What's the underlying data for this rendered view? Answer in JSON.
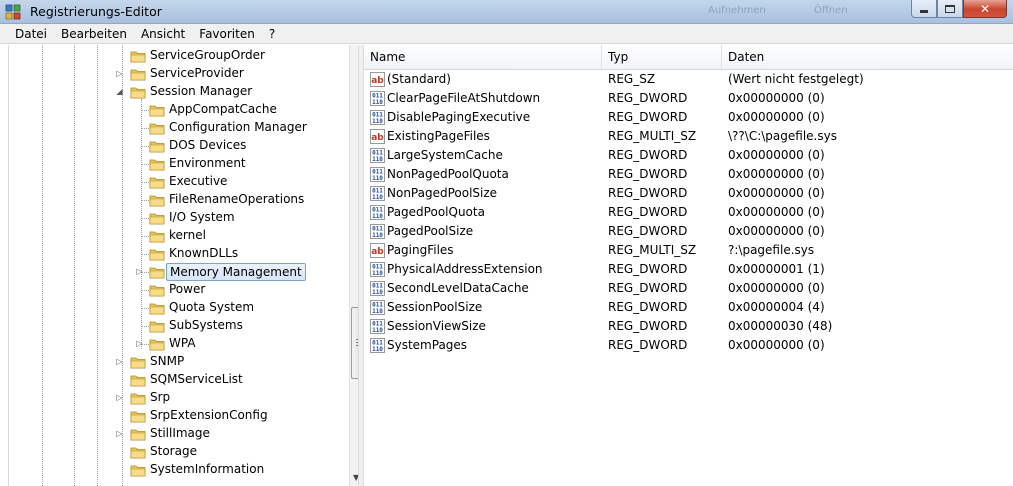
{
  "window": {
    "title": "Registrierungs-Editor",
    "ghost_actions": [
      "Aufnehmen",
      "Öffnen"
    ]
  },
  "menu": [
    "Datei",
    "Bearbeiten",
    "Ansicht",
    "Favoriten",
    "?"
  ],
  "tree": {
    "items": [
      {
        "label": "ServiceGroupOrder",
        "level": 0,
        "expander": "none"
      },
      {
        "label": "ServiceProvider",
        "level": 0,
        "expander": "collapsed"
      },
      {
        "label": "Session Manager",
        "level": 0,
        "expander": "expanded"
      },
      {
        "label": "AppCompatCache",
        "level": 1,
        "expander": "none"
      },
      {
        "label": "Configuration Manager",
        "level": 1,
        "expander": "none"
      },
      {
        "label": "DOS Devices",
        "level": 1,
        "expander": "none"
      },
      {
        "label": "Environment",
        "level": 1,
        "expander": "none"
      },
      {
        "label": "Executive",
        "level": 1,
        "expander": "none"
      },
      {
        "label": "FileRenameOperations",
        "level": 1,
        "expander": "none"
      },
      {
        "label": "I/O System",
        "level": 1,
        "expander": "none"
      },
      {
        "label": "kernel",
        "level": 1,
        "expander": "none"
      },
      {
        "label": "KnownDLLs",
        "level": 1,
        "expander": "none"
      },
      {
        "label": "Memory Management",
        "level": 1,
        "expander": "collapsed",
        "selected": true
      },
      {
        "label": "Power",
        "level": 1,
        "expander": "none"
      },
      {
        "label": "Quota System",
        "level": 1,
        "expander": "none"
      },
      {
        "label": "SubSystems",
        "level": 1,
        "expander": "none"
      },
      {
        "label": "WPA",
        "level": 1,
        "expander": "collapsed"
      },
      {
        "label": "SNMP",
        "level": 0,
        "expander": "collapsed"
      },
      {
        "label": "SQMServiceList",
        "level": 0,
        "expander": "none"
      },
      {
        "label": "Srp",
        "level": 0,
        "expander": "collapsed"
      },
      {
        "label": "SrpExtensionConfig",
        "level": 0,
        "expander": "none"
      },
      {
        "label": "StillImage",
        "level": 0,
        "expander": "collapsed"
      },
      {
        "label": "Storage",
        "level": 0,
        "expander": "none"
      },
      {
        "label": "SystemInformation",
        "level": 0,
        "expander": "none"
      }
    ]
  },
  "list": {
    "columns": [
      "Name",
      "Typ",
      "Daten"
    ],
    "rows": [
      {
        "name": "(Standard)",
        "type": "REG_SZ",
        "data": "(Wert nicht festgelegt)",
        "icon": "string-value-icon"
      },
      {
        "name": "ClearPageFileAtShutdown",
        "type": "REG_DWORD",
        "data": "0x00000000 (0)",
        "icon": "binary-value-icon"
      },
      {
        "name": "DisablePagingExecutive",
        "type": "REG_DWORD",
        "data": "0x00000000 (0)",
        "icon": "binary-value-icon"
      },
      {
        "name": "ExistingPageFiles",
        "type": "REG_MULTI_SZ",
        "data": "\\??\\C:\\pagefile.sys",
        "icon": "string-value-icon"
      },
      {
        "name": "LargeSystemCache",
        "type": "REG_DWORD",
        "data": "0x00000000 (0)",
        "icon": "binary-value-icon"
      },
      {
        "name": "NonPagedPoolQuota",
        "type": "REG_DWORD",
        "data": "0x00000000 (0)",
        "icon": "binary-value-icon"
      },
      {
        "name": "NonPagedPoolSize",
        "type": "REG_DWORD",
        "data": "0x00000000 (0)",
        "icon": "binary-value-icon"
      },
      {
        "name": "PagedPoolQuota",
        "type": "REG_DWORD",
        "data": "0x00000000 (0)",
        "icon": "binary-value-icon"
      },
      {
        "name": "PagedPoolSize",
        "type": "REG_DWORD",
        "data": "0x00000000 (0)",
        "icon": "binary-value-icon"
      },
      {
        "name": "PagingFiles",
        "type": "REG_MULTI_SZ",
        "data": "?:\\pagefile.sys",
        "icon": "string-value-icon"
      },
      {
        "name": "PhysicalAddressExtension",
        "type": "REG_DWORD",
        "data": "0x00000001 (1)",
        "icon": "binary-value-icon"
      },
      {
        "name": "SecondLevelDataCache",
        "type": "REG_DWORD",
        "data": "0x00000000 (0)",
        "icon": "binary-value-icon"
      },
      {
        "name": "SessionPoolSize",
        "type": "REG_DWORD",
        "data": "0x00000004 (4)",
        "icon": "binary-value-icon"
      },
      {
        "name": "SessionViewSize",
        "type": "REG_DWORD",
        "data": "0x00000030 (48)",
        "icon": "binary-value-icon"
      },
      {
        "name": "SystemPages",
        "type": "REG_DWORD",
        "data": "0x00000000 (0)",
        "icon": "binary-value-icon"
      }
    ]
  },
  "colors": {
    "selection_border": "#7da2ce",
    "selection_fill": "#d7e6f8",
    "folder": "#e8c45a"
  }
}
